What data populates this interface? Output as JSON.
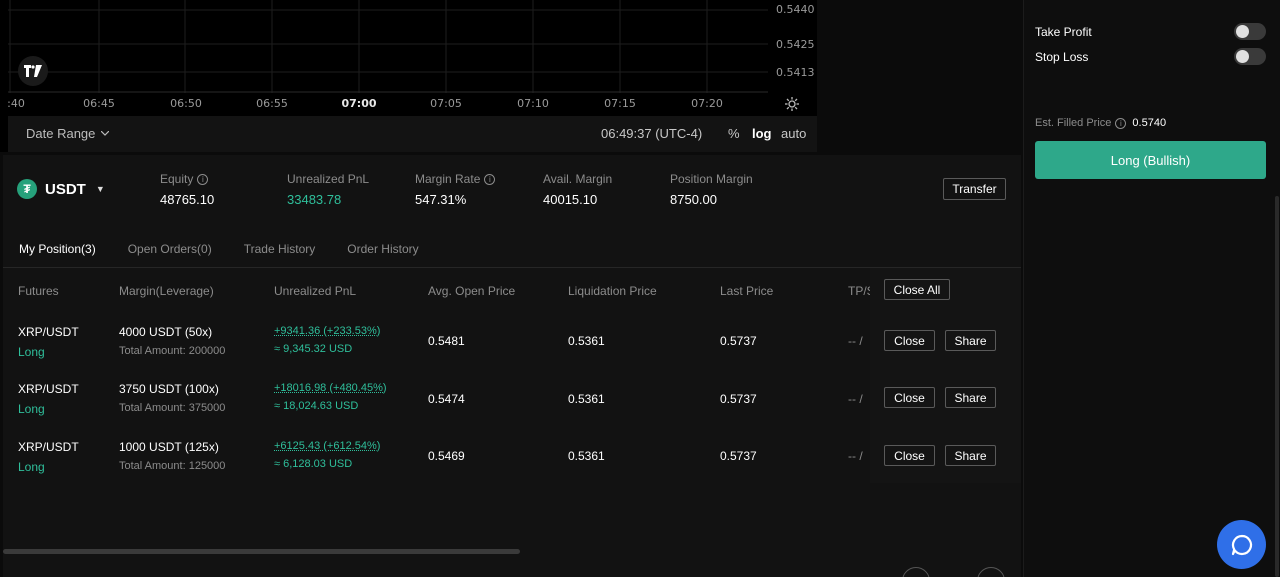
{
  "chart": {
    "price_labels": [
      "0.5440",
      "0.5425",
      "0.5413"
    ],
    "time_labels": [
      ":40",
      "06:45",
      "06:50",
      "06:55",
      "07:00",
      "07:05",
      "07:10",
      "07:15",
      "07:20"
    ],
    "bold_time": "07:00",
    "date_range_label": "Date Range",
    "clock": "06:49:37 (UTC-4)",
    "scale_percent": "%",
    "scale_log": "log",
    "scale_auto": "auto",
    "logo_text": "17"
  },
  "account": {
    "asset": "USDT",
    "asset_symbol": "₮",
    "metrics": [
      {
        "label": "Equity",
        "value": "48765.10",
        "info": true
      },
      {
        "label": "Unrealized PnL",
        "value": "33483.78",
        "info": false,
        "green": true
      },
      {
        "label": "Margin Rate",
        "value": "547.31%",
        "info": true
      },
      {
        "label": "Avail. Margin",
        "value": "40015.10",
        "info": false
      },
      {
        "label": "Position Margin",
        "value": "8750.00",
        "info": false
      }
    ],
    "transfer_label": "Transfer"
  },
  "tabs": [
    "My Position(3)",
    "Open Orders(0)",
    "Trade History",
    "Order History"
  ],
  "table": {
    "headers": [
      "Futures",
      "Margin(Leverage)",
      "Unrealized PnL",
      "Avg. Open Price",
      "Liquidation Price",
      "Last Price",
      "TP/S"
    ],
    "close_all_label": "Close All",
    "close_label": "Close",
    "share_label": "Share",
    "tp_placeholder": "-- /",
    "rows": [
      {
        "pair": "XRP/USDT",
        "side": "Long",
        "margin": "4000 USDT (50x)",
        "total": "Total Amount: 200000",
        "pnl": "+9341.36 (+233.53%)",
        "pnl_usd": "≈ 9,345.32 USD",
        "avg_open": "0.5481",
        "liq": "0.5361",
        "last": "0.5737"
      },
      {
        "pair": "XRP/USDT",
        "side": "Long",
        "margin": "3750 USDT (100x)",
        "total": "Total Amount: 375000",
        "pnl": "+18016.98 (+480.45%)",
        "pnl_usd": "≈ 18,024.63 USD",
        "avg_open": "0.5474",
        "liq": "0.5361",
        "last": "0.5737"
      },
      {
        "pair": "XRP/USDT",
        "side": "Long",
        "margin": "1000 USDT (125x)",
        "total": "Total Amount: 125000",
        "pnl": "+6125.43 (+612.54%)",
        "pnl_usd": "≈ 6,128.03 USD",
        "avg_open": "0.5469",
        "liq": "0.5361",
        "last": "0.5737"
      }
    ]
  },
  "order_panel": {
    "take_profit_label": "Take Profit",
    "stop_loss_label": "Stop Loss",
    "take_profit_on": false,
    "stop_loss_on": false,
    "est_label": "Est. Filled Price",
    "est_value": "0.5740",
    "long_button": "Long (Bullish)"
  },
  "colors": {
    "accent_green": "#2ea88a",
    "pnl_green": "#2fbf9b",
    "chat_blue": "#2f6fe8"
  }
}
